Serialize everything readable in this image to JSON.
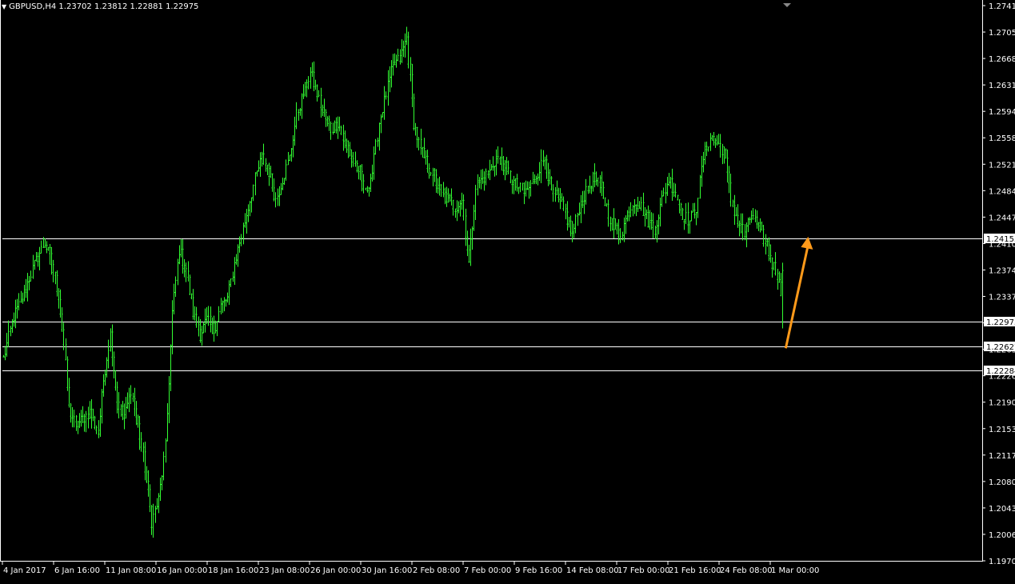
{
  "window": {
    "symbol_label": "GBPUSD,H4",
    "ohlc": [
      "1.23702",
      "1.23812",
      "1.22881",
      "1.22975"
    ]
  },
  "colors": {
    "background": "#000000",
    "candle": "#32ff32",
    "axis": "#ffffff",
    "hline": "#ffffff",
    "arrow": "#ff9a1a",
    "price_marker_bg": "#ffffff",
    "price_marker_text": "#000000"
  },
  "chart_data": {
    "type": "candlestick",
    "symbol": "GBPUSD",
    "timeframe": "H4",
    "last_bar": {
      "open": 1.23702,
      "high": 1.23812,
      "low": 1.22881,
      "close": 1.22975
    },
    "ylim": [
      1.196,
      1.275
    ],
    "y_ticks": [
      "1.27410",
      "1.27050",
      "1.26680",
      "1.26310",
      "1.25940",
      "1.25580",
      "1.25210",
      "1.24840",
      "1.24470",
      "1.24100",
      "1.23740",
      "1.23370",
      "1.23000",
      "1.22630",
      "1.22260",
      "1.21900",
      "1.21530",
      "1.21170",
      "1.20800",
      "1.20430",
      "1.20060",
      "1.19700"
    ],
    "x_ticks": [
      "4 Jan 2017",
      "6 Jan 16:00",
      "11 Jan 08:00",
      "16 Jan 00:00",
      "18 Jan 16:00",
      "23 Jan 08:00",
      "26 Jan 00:00",
      "30 Jan 16:00",
      "2 Feb 08:00",
      "7 Feb 00:00",
      "9 Feb 16:00",
      "14 Feb 08:00",
      "17 Feb 00:00",
      "21 Feb 16:00",
      "24 Feb 08:00",
      "1 Mar 00:00"
    ],
    "horizontal_lines": [
      {
        "value": 1.24155,
        "label": "1.24155"
      },
      {
        "value": 1.22975,
        "label": "1.22975"
      },
      {
        "value": 1.22627,
        "label": "1.22627"
      },
      {
        "value": 1.22284,
        "label": "1.22284"
      }
    ],
    "arrow": {
      "from_bar_offset": 2,
      "from_price": 1.226,
      "to_bar_offset": 15,
      "to_price": 1.2418
    },
    "close_path": [
      [
        0,
        1.2245
      ],
      [
        6,
        1.2305
      ],
      [
        11,
        1.233
      ],
      [
        15,
        1.236
      ],
      [
        20,
        1.239
      ],
      [
        24,
        1.241
      ],
      [
        28,
        1.238
      ],
      [
        32,
        1.2335
      ],
      [
        35,
        1.2265
      ],
      [
        38,
        1.2175
      ],
      [
        42,
        1.215
      ],
      [
        46,
        1.216
      ],
      [
        50,
        1.217
      ],
      [
        55,
        1.214
      ],
      [
        58,
        1.2215
      ],
      [
        62,
        1.228
      ],
      [
        66,
        1.2185
      ],
      [
        70,
        1.216
      ],
      [
        74,
        1.22
      ],
      [
        78,
        1.215
      ],
      [
        82,
        1.209
      ],
      [
        86,
        1.2015
      ],
      [
        90,
        1.2045
      ],
      [
        94,
        1.212
      ],
      [
        98,
        1.231
      ],
      [
        102,
        1.24
      ],
      [
        106,
        1.237
      ],
      [
        110,
        1.231
      ],
      [
        114,
        1.228
      ],
      [
        118,
        1.23
      ],
      [
        122,
        1.2285
      ],
      [
        126,
        1.232
      ],
      [
        130,
        1.233
      ],
      [
        134,
        1.238
      ],
      [
        138,
        1.242
      ],
      [
        142,
        1.246
      ],
      [
        146,
        1.25
      ],
      [
        150,
        1.253
      ],
      [
        154,
        1.251
      ],
      [
        158,
        1.247
      ],
      [
        162,
        1.25
      ],
      [
        166,
        1.253
      ],
      [
        170,
        1.259
      ],
      [
        174,
        1.262
      ],
      [
        178,
        1.265
      ],
      [
        182,
        1.262
      ],
      [
        186,
        1.259
      ],
      [
        190,
        1.257
      ],
      [
        194,
        1.258
      ],
      [
        198,
        1.255
      ],
      [
        202,
        1.253
      ],
      [
        206,
        1.251
      ],
      [
        210,
        1.248
      ],
      [
        214,
        1.251
      ],
      [
        218,
        1.258
      ],
      [
        222,
        1.262
      ],
      [
        226,
        1.266
      ],
      [
        230,
        1.267
      ],
      [
        234,
        1.27
      ],
      [
        238,
        1.258
      ],
      [
        242,
        1.254
      ],
      [
        246,
        1.252
      ],
      [
        250,
        1.25
      ],
      [
        254,
        1.248
      ],
      [
        258,
        1.247
      ],
      [
        262,
        1.246
      ],
      [
        266,
        1.247
      ],
      [
        270,
        1.238
      ],
      [
        274,
        1.249
      ],
      [
        278,
        1.25
      ],
      [
        282,
        1.251
      ],
      [
        286,
        1.253
      ],
      [
        290,
        1.252
      ],
      [
        294,
        1.25
      ],
      [
        298,
        1.249
      ],
      [
        302,
        1.248
      ],
      [
        306,
        1.249
      ],
      [
        310,
        1.251
      ],
      [
        314,
        1.253
      ],
      [
        318,
        1.248
      ],
      [
        322,
        1.247
      ],
      [
        326,
        1.245
      ],
      [
        330,
        1.242
      ],
      [
        334,
        1.246
      ],
      [
        338,
        1.248
      ],
      [
        342,
        1.25
      ],
      [
        346,
        1.249
      ],
      [
        350,
        1.246
      ],
      [
        354,
        1.243
      ],
      [
        358,
        1.242
      ],
      [
        362,
        1.245
      ],
      [
        366,
        1.247
      ],
      [
        370,
        1.246
      ],
      [
        374,
        1.244
      ],
      [
        378,
        1.243
      ],
      [
        382,
        1.247
      ],
      [
        386,
        1.25
      ],
      [
        390,
        1.248
      ],
      [
        394,
        1.245
      ],
      [
        398,
        1.244
      ],
      [
        402,
        1.246
      ],
      [
        406,
        1.253
      ],
      [
        410,
        1.256
      ],
      [
        414,
        1.255
      ],
      [
        418,
        1.254
      ],
      [
        422,
        1.247
      ],
      [
        426,
        1.244
      ],
      [
        430,
        1.242
      ],
      [
        434,
        1.245
      ],
      [
        438,
        1.243
      ],
      [
        442,
        1.241
      ],
      [
        446,
        1.238
      ],
      [
        450,
        1.236
      ],
      [
        452,
        1.22975
      ]
    ]
  }
}
